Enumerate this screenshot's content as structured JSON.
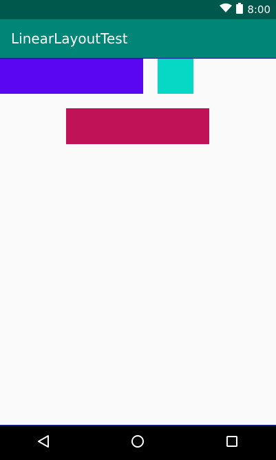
{
  "status_bar": {
    "time": "8:00",
    "icons": [
      "wifi-icon",
      "battery-icon"
    ],
    "background": "#00574b"
  },
  "app_bar": {
    "title": "LinearLayoutTest",
    "background": "#008577"
  },
  "content": {
    "background": "#fafafa",
    "blocks": [
      {
        "name": "purple",
        "color": "#5a06f0"
      },
      {
        "name": "teal",
        "color": "#05d8c4"
      },
      {
        "name": "magenta",
        "color": "#c01357"
      }
    ]
  },
  "nav_bar": {
    "buttons": [
      "back-icon",
      "home-icon",
      "recents-icon"
    ],
    "background": "#000000"
  }
}
